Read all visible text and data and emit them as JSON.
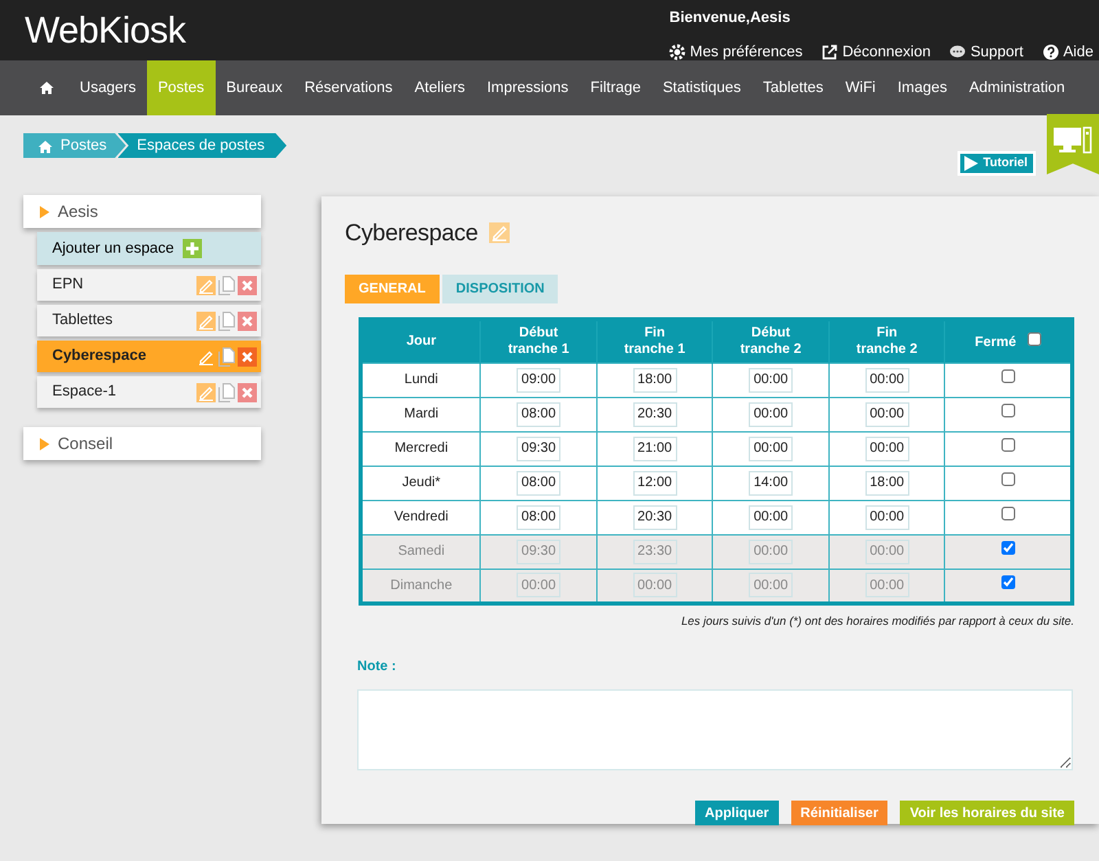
{
  "header": {
    "logo": "WebKiosk",
    "greeting": "Bienvenue,Aesis",
    "links": [
      {
        "kind": "gear",
        "label": "Mes préférences"
      },
      {
        "kind": "exit",
        "label": "Déconnexion"
      },
      {
        "kind": "chat",
        "label": "Support"
      },
      {
        "kind": "help",
        "label": "Aide"
      }
    ]
  },
  "nav": [
    {
      "label": "Usagers",
      "selected": false
    },
    {
      "label": "Postes",
      "selected": true
    },
    {
      "label": "Bureaux",
      "selected": false
    },
    {
      "label": "Réservations",
      "selected": false
    },
    {
      "label": "Ateliers",
      "selected": false
    },
    {
      "label": "Impressions",
      "selected": false
    },
    {
      "label": "Filtrage",
      "selected": false
    },
    {
      "label": "Statistiques",
      "selected": false
    },
    {
      "label": "Tablettes",
      "selected": false
    },
    {
      "label": "WiFi",
      "selected": false
    },
    {
      "label": "Images",
      "selected": false
    },
    {
      "label": "Administration",
      "selected": false
    }
  ],
  "breadcrumb": [
    "Postes",
    "Espaces de postes"
  ],
  "tutorial": "Tutoriel",
  "sidebar": {
    "groups": [
      {
        "label": "Aesis",
        "add": "Ajouter un espace",
        "items": [
          {
            "label": "EPN",
            "selected": false
          },
          {
            "label": "Tablettes",
            "selected": false
          },
          {
            "label": "Cyberespace",
            "selected": true
          },
          {
            "label": "Espace-1",
            "selected": false
          }
        ]
      },
      {
        "label": "Conseil"
      }
    ]
  },
  "panel": {
    "title": "Cyberespace",
    "tabs": [
      {
        "label": "GENERAL",
        "selected": true
      },
      {
        "label": "DISPOSITION",
        "selected": false
      }
    ],
    "table": {
      "columns": [
        "Jour",
        "Début\ntranche 1",
        "Fin\ntranche 1",
        "Début\ntranche 2",
        "Fin\ntranche 2",
        "Fermé"
      ],
      "all_closed": false,
      "rows": [
        {
          "day": "Lundi",
          "times": [
            "09:00",
            "18:00",
            "00:00",
            "00:00"
          ],
          "closed": false
        },
        {
          "day": "Mardi",
          "times": [
            "08:00",
            "20:30",
            "00:00",
            "00:00"
          ],
          "closed": false
        },
        {
          "day": "Mercredi",
          "times": [
            "09:30",
            "21:00",
            "00:00",
            "00:00"
          ],
          "closed": false
        },
        {
          "day": "Jeudi*",
          "times": [
            "08:00",
            "12:00",
            "14:00",
            "18:00"
          ],
          "closed": false
        },
        {
          "day": "Vendredi",
          "times": [
            "08:00",
            "20:30",
            "00:00",
            "00:00"
          ],
          "closed": false
        },
        {
          "day": "Samedi",
          "times": [
            "09:30",
            "23:30",
            "00:00",
            "00:00"
          ],
          "closed": true
        },
        {
          "day": "Dimanche",
          "times": [
            "00:00",
            "00:00",
            "00:00",
            "00:00"
          ],
          "closed": true
        }
      ]
    },
    "footnote": "Les jours suivis d'un (*) ont des horaires modifiés par rapport à ceux du site.",
    "note_label": "Note :",
    "buttons": [
      {
        "label": "Appliquer",
        "kind": "primary"
      },
      {
        "label": "Réinitialiser",
        "kind": "reset"
      },
      {
        "label": "Voir les horaires du site",
        "kind": "site"
      }
    ]
  }
}
